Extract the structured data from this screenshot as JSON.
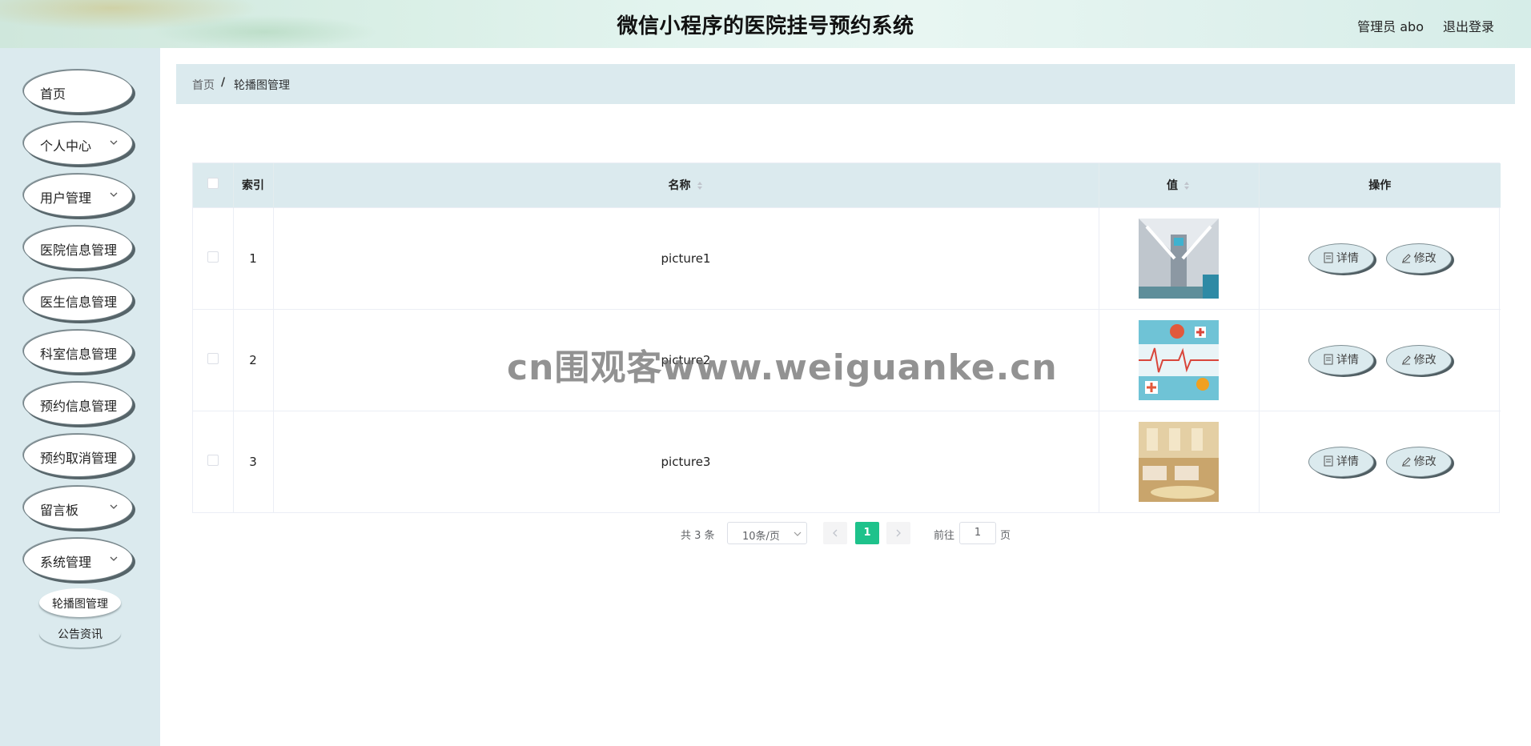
{
  "header": {
    "title": "微信小程序的医院挂号预约系统",
    "user": "管理员 abo",
    "logout": "退出登录"
  },
  "sidebar": {
    "items": [
      {
        "label": "首页",
        "has_chevron": false
      },
      {
        "label": "个人中心",
        "has_chevron": true
      },
      {
        "label": "用户管理",
        "has_chevron": true
      },
      {
        "label": "医院信息管理",
        "has_chevron": false
      },
      {
        "label": "医生信息管理",
        "has_chevron": false
      },
      {
        "label": "科室信息管理",
        "has_chevron": false
      },
      {
        "label": "预约信息管理",
        "has_chevron": false
      },
      {
        "label": "预约取消管理",
        "has_chevron": false
      },
      {
        "label": "留言板",
        "has_chevron": true
      },
      {
        "label": "系统管理",
        "has_chevron": true
      }
    ],
    "submenu": [
      {
        "label": "轮播图管理",
        "active": true
      },
      {
        "label": "公告资讯",
        "active": false
      }
    ]
  },
  "breadcrumb": {
    "home": "首页",
    "separator": "/",
    "current": "轮播图管理"
  },
  "table": {
    "columns": {
      "index": "索引",
      "name": "名称",
      "value": "值",
      "actions": "操作"
    },
    "rows": [
      {
        "index": "1",
        "name": "picture1",
        "thumb": "hospital-corridor-image"
      },
      {
        "index": "2",
        "name": "picture2",
        "thumb": "medical-pattern-image"
      },
      {
        "index": "3",
        "name": "picture3",
        "thumb": "hospital-ward-image"
      }
    ],
    "detail_label": "详情",
    "edit_label": "修改"
  },
  "pagination": {
    "total": "共 3 条",
    "page_size": "10条/页",
    "current_page": "1",
    "goto_label": "前往",
    "goto_value": "1",
    "page_suffix": "页"
  },
  "watermark": "cn围观客www.weiguanke.cn",
  "colors": {
    "accent": "#1ec28b",
    "panel": "#dbeaee"
  }
}
